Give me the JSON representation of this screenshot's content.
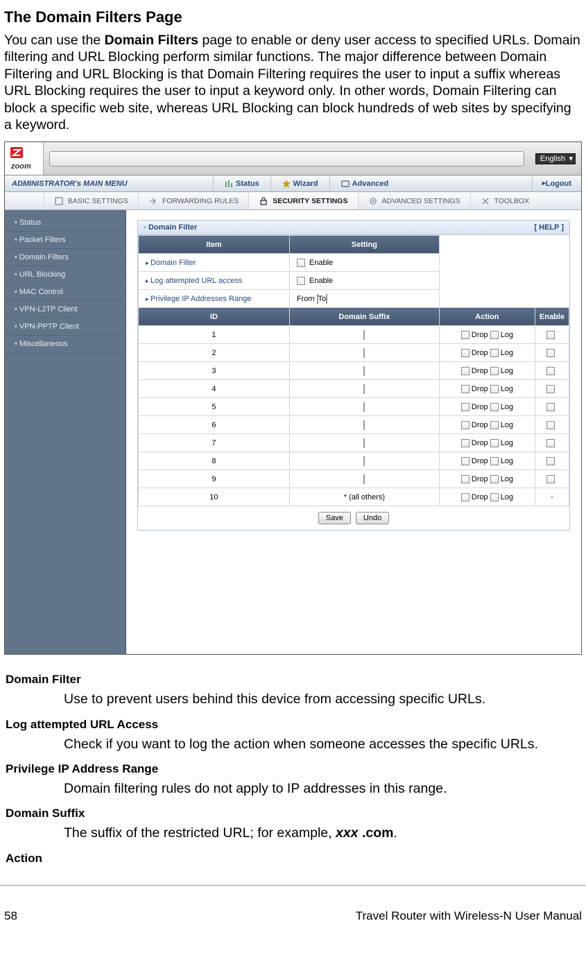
{
  "doc": {
    "title": "The Domain Filters Page",
    "intro_pre": "You can use the ",
    "intro_bold": "Domain Filters",
    "intro_post": " page to enable or deny user access to specified URLs. Domain filtering and URL Blocking perform similar functions. The major difference between Domain Filtering and URL Blocking is that Domain Filtering requires the user to input a suffix whereas URL Blocking requires the user to input a keyword only. In other words, Domain Filtering can block a specific web site, whereas URL Blocking can block hundreds of web sites by specifying a keyword."
  },
  "ui": {
    "language": "English",
    "mainmenu": {
      "title": "ADMINISTRATOR's MAIN MENU",
      "status": "Status",
      "wizard": "Wizard",
      "advanced": "Advanced",
      "logout": "Logout"
    },
    "tabs": {
      "basic": "BASIC SETTINGS",
      "forwarding": "FORWARDING RULES",
      "security": "SECURITY SETTINGS",
      "advanced": "ADVANCED SETTINGS",
      "toolbox": "TOOLBOX"
    },
    "sidebar": [
      "Status",
      "Packet Filters",
      "Domain Filters",
      "URL Blocking",
      "MAC Control",
      "VPN-L2TP Client",
      "VPN-PPTP Client",
      "Miscellaneous"
    ],
    "panel": {
      "title": "Domain Filter",
      "help": "[ HELP ]",
      "col_item": "Item",
      "col_setting": "Setting",
      "row_domain_filter": "Domain Filter",
      "row_log_attempt": "Log attempted URL access",
      "row_privilege": "Privilege IP Addresses Range",
      "enable_label": "Enable",
      "from_label": "From",
      "to_label": "To",
      "col_id": "ID",
      "col_domain_suffix": "Domain Suffix",
      "col_action": "Action",
      "col_enable": "Enable",
      "drop_label": "Drop",
      "log_label": "Log",
      "ids": [
        "1",
        "2",
        "3",
        "4",
        "5",
        "6",
        "7",
        "8",
        "9",
        "10"
      ],
      "all_others": "* (all others)",
      "save": "Save",
      "undo": "Undo"
    }
  },
  "defs": {
    "domain_filter_t": "Domain Filter",
    "domain_filter_d": "Use to prevent users behind this device from accessing specific URLs.",
    "log_t": "Log attempted URL Access",
    "log_d": "Check if you want to log the action when someone accesses the specific URLs.",
    "priv_t": "Privilege IP Address Range",
    "priv_d": "Domain filtering rules do not apply to IP addresses in this range.",
    "suffix_t": "Domain Suffix",
    "suffix_d_pre": "The suffix of the restricted URL; for example, ",
    "suffix_d_biex": "xxx",
    "suffix_d_mid": " ",
    "suffix_d_bex": ".com",
    "suffix_d_post": ".",
    "action_t": "Action"
  },
  "footer": {
    "page": "58",
    "manual": "Travel Router with Wireless-N User Manual"
  }
}
